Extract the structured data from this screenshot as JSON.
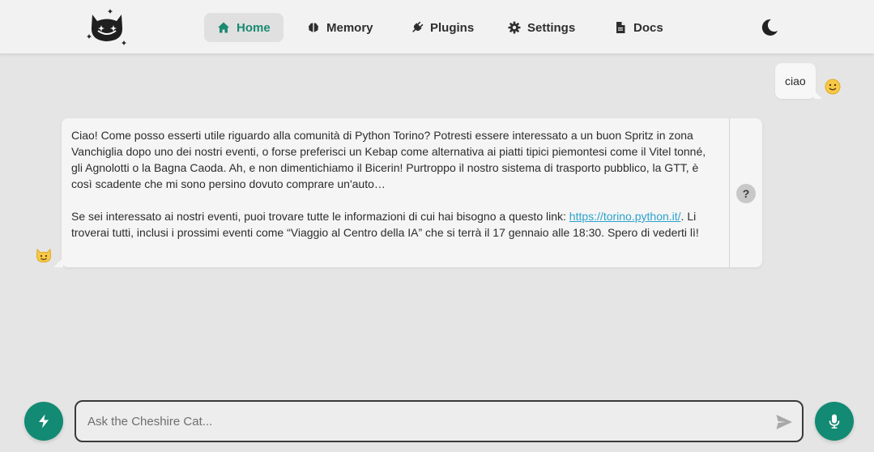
{
  "theme": {
    "accent": "#138a73",
    "link": "#2ba3cc",
    "background": "#e5e5e5"
  },
  "nav": {
    "logo_icon": "cheshire-cat-logo",
    "items": [
      {
        "label": "Home",
        "icon": "home-icon",
        "active": true
      },
      {
        "label": "Memory",
        "icon": "brain-icon",
        "active": false
      },
      {
        "label": "Plugins",
        "icon": "plug-icon",
        "active": false
      },
      {
        "label": "Settings",
        "icon": "gear-icon",
        "active": false
      },
      {
        "label": "Docs",
        "icon": "document-icon",
        "active": false
      }
    ],
    "theme_toggle_icon": "moon-icon"
  },
  "messages": {
    "user": {
      "text": "ciao",
      "avatar_icon": "smiley-emoji"
    },
    "bot": {
      "paragraph1": "Ciao! Come posso esserti utile riguardo alla comunità di Python Torino? Potresti essere interessato a un buon Spritz in zona Vanchiglia dopo uno dei nostri eventi, o forse preferisci un Kebap come alternativa ai piatti tipici piemontesi come il Vitel tonné, gli Agnolotti o la Bagna Caoda. Ah, e non dimentichiamo il Bicerin! Purtroppo il nostro sistema di trasporto pubblico, la GTT, è così scadente che mi sono persino dovuto comprare un'auto…",
      "paragraph2_before": "Se sei interessato ai nostri eventi, puoi trovare tutte le informazioni di cui hai bisogno a questo link: ",
      "link_text": "https://torino.python.it/",
      "paragraph2_after": ". Li troverai tutti, inclusi i prossimi eventi come “Viaggio al Centro della IA” che si terrà il 17 gennaio alle 18:30. Spero di vederti lì!",
      "why_label": "?",
      "avatar_icon": "cat-emoji"
    }
  },
  "input": {
    "placeholder": "Ask the Cheshire Cat...",
    "value": "",
    "tools_icon": "lightning-icon",
    "send_icon": "send-icon",
    "mic_icon": "microphone-icon"
  }
}
